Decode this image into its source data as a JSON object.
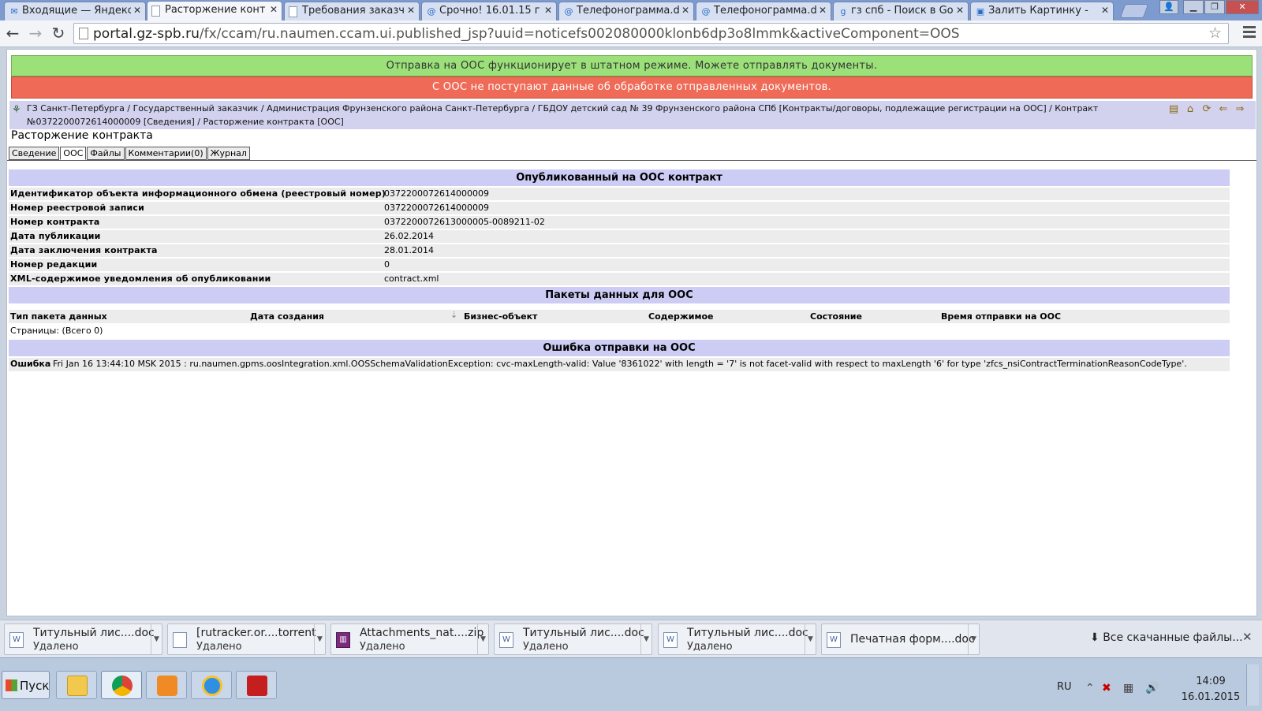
{
  "browser": {
    "tabs": [
      {
        "label": "Входящие — Яндекс",
        "icon": "mail-icon",
        "active": false
      },
      {
        "label": "Расторжение конт",
        "icon": "document-icon",
        "active": true
      },
      {
        "label": "Требования заказч",
        "icon": "document-icon",
        "active": false
      },
      {
        "label": "Срочно! 16.01.15 г",
        "icon": "mailru-icon",
        "active": false
      },
      {
        "label": "Телефонограмма.d",
        "icon": "mailru-icon",
        "active": false
      },
      {
        "label": "Телефонограмма.d",
        "icon": "mailru-icon",
        "active": false
      },
      {
        "label": "гз спб - Поиск в Go",
        "icon": "google-icon",
        "active": false
      },
      {
        "label": "Залить Картинку -",
        "icon": "image-icon",
        "active": false
      }
    ],
    "url_host": "portal.gz-spb.ru",
    "url_path": "/fx/ccam/ru.naumen.ccam.ui.published_jsp?uuid=noticefs002080000klonb6dp3o8lmmk&activeComponent=OOS"
  },
  "page": {
    "banner_ok": "Отправка на ООС функционирует в штатном режиме. Можете отправлять документы.",
    "banner_error": "С ООС не поступают данные об обработке отправленных документов.",
    "breadcrumb": "ГЗ Санкт-Петербурга / Государственный заказчик / Администрация Фрунзенского района Санкт-Петербурга / ГБДОУ детский сад № 39 Фрунзенского района СПб [Контракты/договоры, подлежащие регистрации на ООС] / Контракт №0372200072614000009 [Сведения] / Расторжение контракта [ООС]",
    "title": "Расторжение контракта",
    "tabs": [
      "Сведение",
      "ООС",
      "Файлы",
      "Комментарии(0)",
      "Журнал"
    ],
    "published_section": {
      "heading": "Опубликованный на ООС контракт",
      "fields": [
        {
          "label": "Идентификатор объекта информационного обмена (реестровый номер)",
          "value": "0372200072614000009"
        },
        {
          "label": "Номер реестровой записи",
          "value": "0372200072614000009"
        },
        {
          "label": "Номер контракта",
          "value": "0372200072613000005-0089211-02"
        },
        {
          "label": "Дата публикации",
          "value": "26.02.2014"
        },
        {
          "label": "Дата заключения контракта",
          "value": "28.01.2014"
        },
        {
          "label": "Номер редакции",
          "value": "0"
        },
        {
          "label": "XML-содержимое уведомления об опубликовании",
          "value": "contract.xml"
        }
      ]
    },
    "packets_section": {
      "heading": "Пакеты данных для ООС",
      "columns": [
        "Тип пакета данных",
        "Дата создания",
        "Бизнес-объект",
        "Содержимое",
        "Состояние",
        "Время отправки на ООС"
      ],
      "pager": "Страницы:  (Всего 0)"
    },
    "error_section": {
      "heading": "Ошибка отправки на ООС",
      "label": "Ошибка",
      "message": "Fri Jan 16 13:44:10 MSK 2015 : ru.naumen.gpms.oosIntegration.xml.OOSSchemaValidationException: cvc-maxLength-valid: Value '8361022' with length = '7' is not facet-valid with respect to maxLength '6' for type 'zfcs_nsiContractTerminationReasonCodeType'."
    }
  },
  "downloads": {
    "items": [
      {
        "name": "Титульный лис....doc",
        "status": "Удалено",
        "icon": "word-doc-icon"
      },
      {
        "name": "[rutracker.or....torrent",
        "status": "Удалено",
        "icon": "file-icon"
      },
      {
        "name": "Attachments_nat....zip",
        "status": "Удалено",
        "icon": "zip-icon"
      },
      {
        "name": "Титульный лис....doc",
        "status": "Удалено",
        "icon": "word-doc-icon"
      },
      {
        "name": "Титульный лис....doc",
        "status": "Удалено",
        "icon": "word-doc-icon"
      },
      {
        "name": "Печатная форм....doc",
        "status": "",
        "icon": "word-doc-icon"
      }
    ],
    "show_all": "Все скачанные файлы..."
  },
  "taskbar": {
    "start_label": "Пуск",
    "lang": "RU",
    "time": "14:09",
    "date": "16.01.2015"
  },
  "colors": {
    "banner_ok": "#9ce07a",
    "banner_error": "#ef6b57",
    "section_header": "#ccccf5"
  }
}
